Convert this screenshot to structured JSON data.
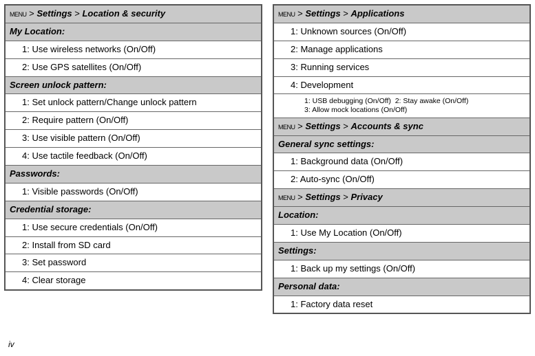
{
  "page_number": "iv",
  "menu_label": "MENU",
  "left": {
    "path": {
      "prefix": "> ",
      "settings": "Settings",
      "sep": " > ",
      "page": "Location & security"
    },
    "sections": [
      {
        "header": "My Location:",
        "items": [
          "1: Use wireless networks (On/Off)",
          "2: Use GPS satellites (On/Off)"
        ]
      },
      {
        "header": "Screen unlock pattern:",
        "items": [
          "1: Set unlock pattern/Change unlock pattern",
          "2: Require pattern (On/Off)",
          "3: Use visible pattern (On/Off)",
          "4: Use tactile feedback (On/Off)"
        ]
      },
      {
        "header": "Passwords:",
        "items": [
          "1: Visible passwords (On/Off)"
        ]
      },
      {
        "header": "Credential storage:",
        "items": [
          "1: Use secure credentials (On/Off)",
          "2: Install from SD card",
          "3: Set password",
          "4: Clear storage"
        ]
      }
    ]
  },
  "right_blocks": [
    {
      "path": {
        "prefix": "> ",
        "settings": "Settings",
        "sep": " > ",
        "page": "Applications"
      },
      "sections": [
        {
          "header": null,
          "items": [
            "1: Unknown sources (On/Off)",
            "2: Manage applications",
            "3: Running services",
            "4: Development"
          ],
          "sub": "1: USB debugging (On/Off)  2: Stay awake (On/Off)\n3: Allow mock locations (On/Off)"
        }
      ]
    },
    {
      "path": {
        "prefix": "> ",
        "settings": "Settings",
        "sep": " > ",
        "page": "Accounts & sync"
      },
      "sections": [
        {
          "header": "General sync settings:",
          "items": [
            "1: Background data (On/Off)",
            "2: Auto-sync (On/Off)"
          ]
        }
      ]
    },
    {
      "path": {
        "prefix": "> ",
        "settings": "Settings",
        "sep": " > ",
        "page": "Privacy"
      },
      "sections": [
        {
          "header": "Location:",
          "items": [
            "1: Use My Location (On/Off)"
          ]
        },
        {
          "header": "Settings:",
          "items": [
            "1: Back up my settings (On/Off)"
          ]
        },
        {
          "header": "Personal data:",
          "items": [
            "1: Factory data reset"
          ]
        }
      ]
    }
  ]
}
